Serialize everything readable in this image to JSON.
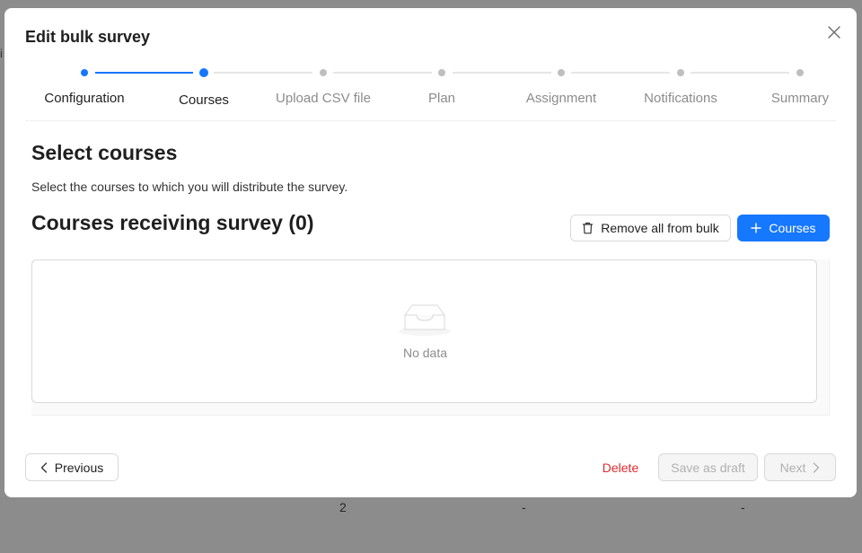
{
  "background": {
    "left_fragment": "i",
    "row_values": [
      "2",
      "-",
      "-"
    ]
  },
  "modal": {
    "title": "Edit bulk survey",
    "close_icon": "close-icon"
  },
  "steps": [
    {
      "label": "Configuration",
      "status": "done"
    },
    {
      "label": "Courses",
      "status": "current"
    },
    {
      "label": "Upload CSV file",
      "status": "pending"
    },
    {
      "label": "Plan",
      "status": "pending"
    },
    {
      "label": "Assignment",
      "status": "pending"
    },
    {
      "label": "Notifications",
      "status": "pending"
    },
    {
      "label": "Summary",
      "status": "pending"
    }
  ],
  "content": {
    "title": "Select courses",
    "description": "Select the courses to which you will distribute the survey.",
    "list_title": "Courses receiving survey (0)",
    "remove_all_label": "Remove all from bulk",
    "add_courses_label": "Courses",
    "empty_text": "No data"
  },
  "footer": {
    "previous_label": "Previous",
    "delete_label": "Delete",
    "save_draft_label": "Save as draft",
    "next_label": "Next"
  },
  "colors": {
    "primary": "#1677ff",
    "danger": "#e0282e",
    "disabled_text": "#b0b0b0"
  }
}
